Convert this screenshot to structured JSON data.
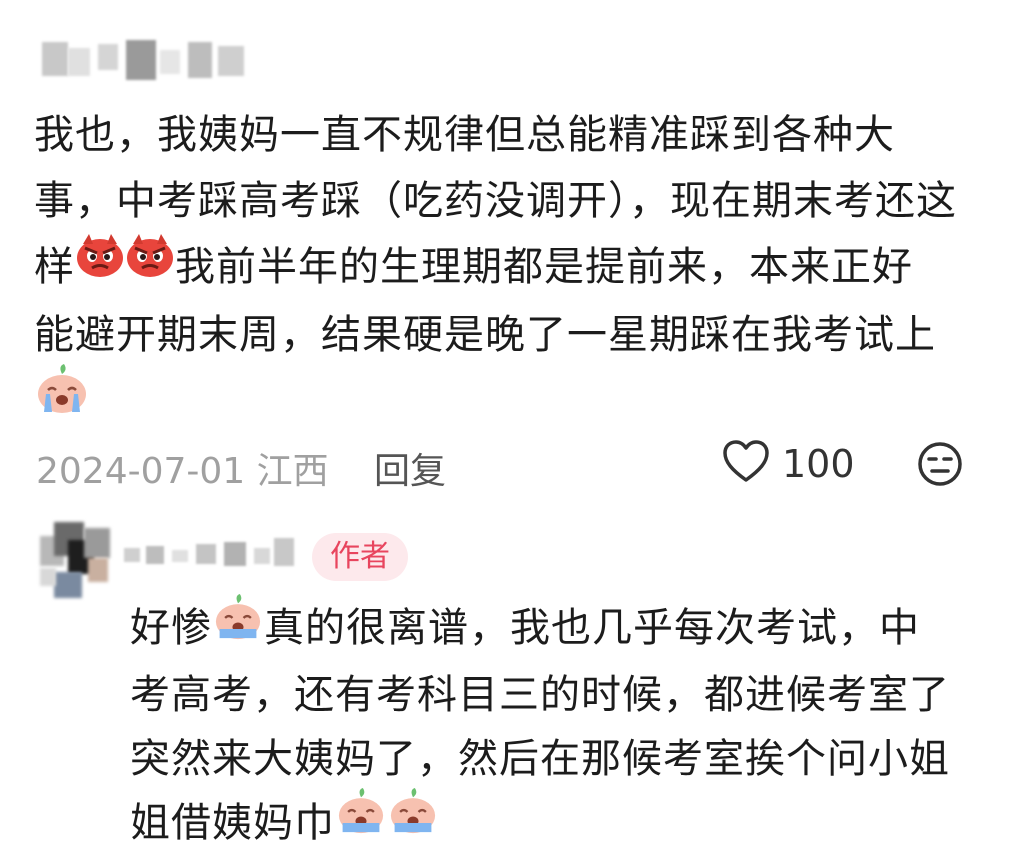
{
  "comment": {
    "line1": "我也，我姨妈一直不规律但总能精准踩到各种大",
    "line2": "事，中考踩高考踩（吃药没调开），现在期末考还这",
    "line3_pre": "样",
    "line3_post": "我前半年的生理期都是提前来，本来正好",
    "line4": "能避开期末周，结果硬是晚了一星期踩在我考试上",
    "angry_emoji": "angry-face-emoji",
    "crying_emoji": "crying-peach-emoji"
  },
  "meta": {
    "date_location": "2024-07-01 江西",
    "reply_label": "回复",
    "like_count": "100",
    "like_icon": "heart-outline-icon",
    "dislike_icon": "unamused-face-icon"
  },
  "reply": {
    "badge": "作者",
    "line1_pre": "好惨",
    "line1_post": "真的很离谱，我也几乎每次考试，中",
    "line2": "考高考，还有考科目三的时候，都进候考室了",
    "line3": "突然来大姨妈了，然后在那候考室挨个问小姐",
    "line4": "姐借姨妈巾",
    "crying_emoji": "crying-peach-emoji"
  },
  "colors": {
    "badge_bg": "#fde9ec",
    "badge_text": "#e8455e",
    "meta_gray": "#a0a0a0"
  }
}
